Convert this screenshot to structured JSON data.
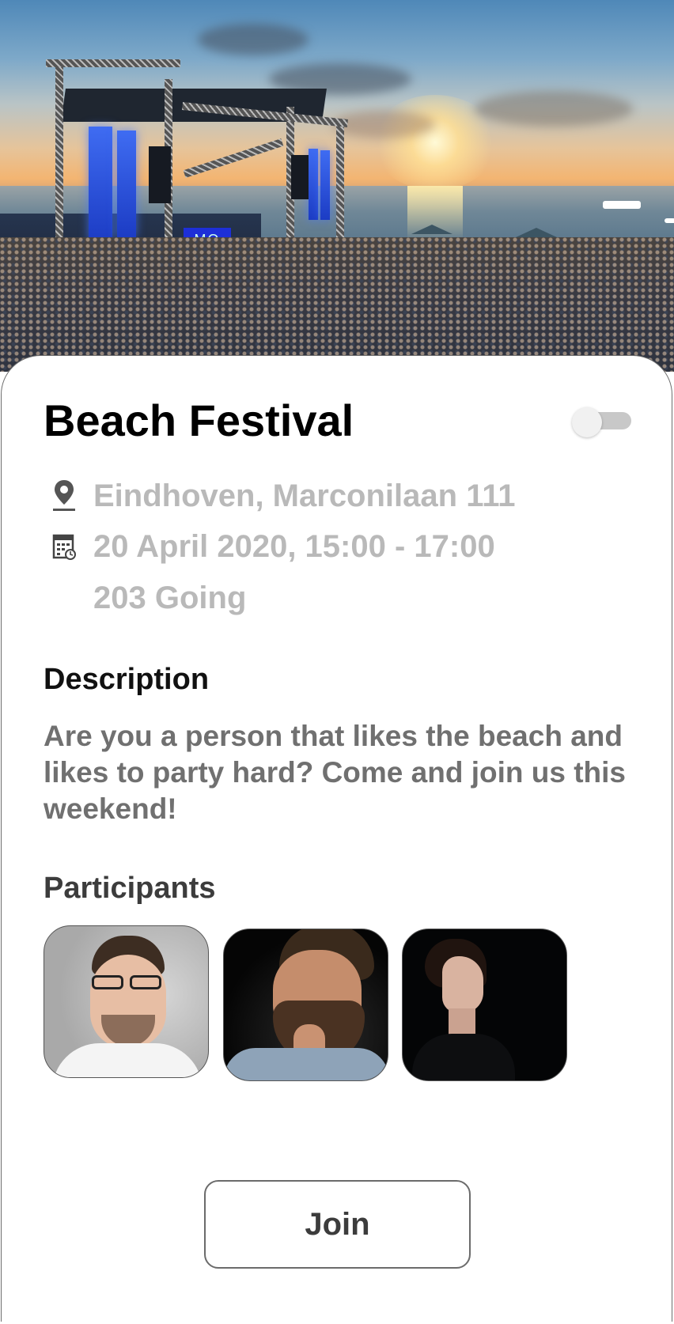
{
  "event": {
    "title": "Beach Festival",
    "location": "Eindhoven, Marconilaan 111",
    "datetime": "20 April 2020, 15:00 - 17:00",
    "attendance": "203 Going"
  },
  "description": {
    "heading": "Description",
    "text": "Are you a person that likes the beach and likes to party hard? Come and join us this weekend!"
  },
  "participants": {
    "heading": "Participants",
    "avatars": [
      "avatar-glasses-man",
      "avatar-bearded-man",
      "avatar-woman-profile"
    ]
  },
  "toggle": {
    "state": "off"
  },
  "actions": {
    "join_label": "Join"
  },
  "icons": {
    "location": "location-pin-icon",
    "calendar": "calendar-icon"
  },
  "colors": {
    "title": "#000000",
    "meta_text": "#b9b9b9",
    "body_text": "#707070",
    "border": "#6d6d6d"
  }
}
